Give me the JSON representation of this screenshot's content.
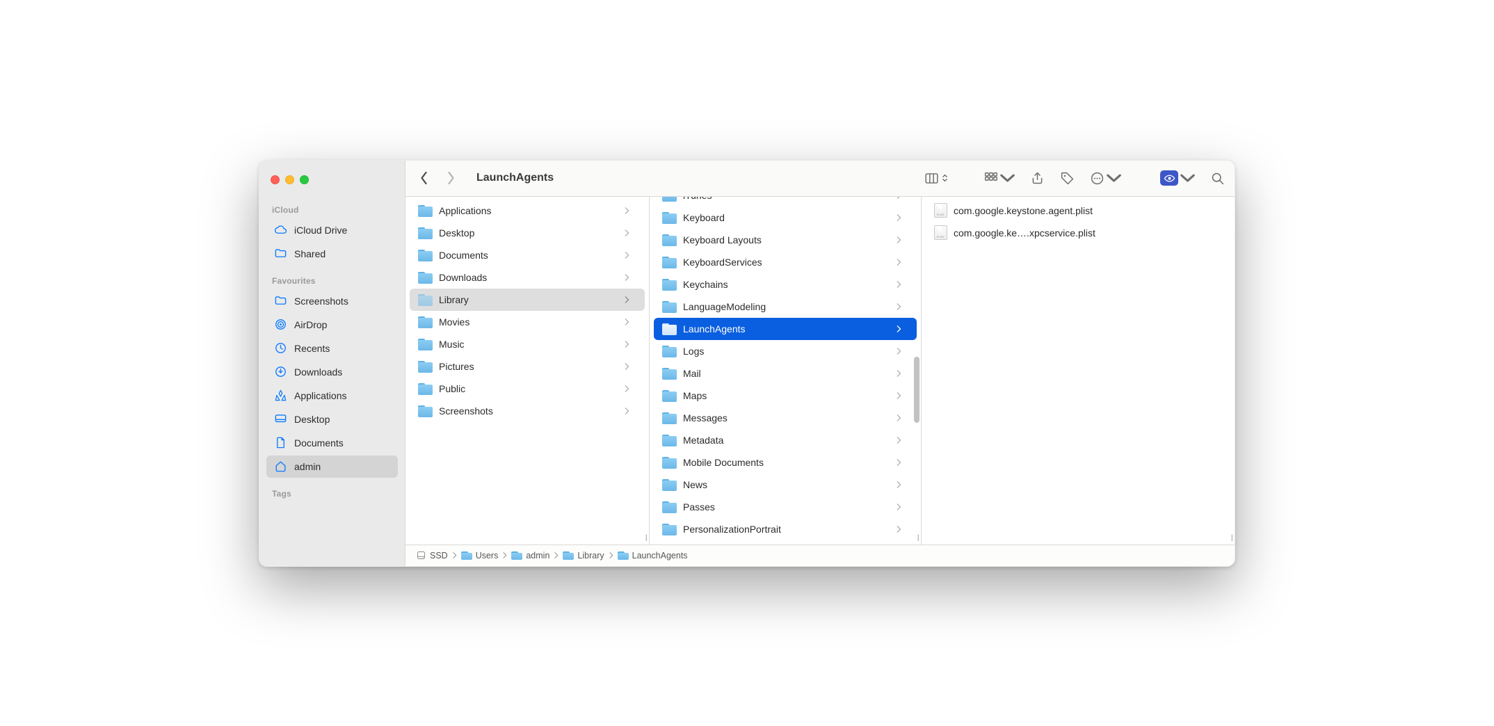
{
  "window_title": "LaunchAgents",
  "sidebar": {
    "sections": [
      {
        "header": "iCloud",
        "items": [
          {
            "icon": "cloud",
            "label": "iCloud Drive"
          },
          {
            "icon": "folder-shared",
            "label": "Shared"
          }
        ]
      },
      {
        "header": "Favourites",
        "items": [
          {
            "icon": "folder",
            "label": "Screenshots"
          },
          {
            "icon": "airdrop",
            "label": "AirDrop"
          },
          {
            "icon": "clock",
            "label": "Recents"
          },
          {
            "icon": "download",
            "label": "Downloads"
          },
          {
            "icon": "apps",
            "label": "Applications"
          },
          {
            "icon": "desktop",
            "label": "Desktop"
          },
          {
            "icon": "document",
            "label": "Documents"
          },
          {
            "icon": "home",
            "label": "admin",
            "selected": true
          }
        ]
      },
      {
        "header": "Tags",
        "items": []
      }
    ]
  },
  "columns": [
    {
      "items": [
        {
          "type": "folder",
          "label": "Applications",
          "has_children": true
        },
        {
          "type": "folder",
          "label": "Desktop",
          "has_children": true
        },
        {
          "type": "folder",
          "label": "Documents",
          "has_children": true
        },
        {
          "type": "folder",
          "label": "Downloads",
          "has_children": true
        },
        {
          "type": "folder",
          "label": "Library",
          "has_children": true,
          "open": true
        },
        {
          "type": "folder",
          "label": "Movies",
          "has_children": true
        },
        {
          "type": "folder",
          "label": "Music",
          "has_children": true
        },
        {
          "type": "folder",
          "label": "Pictures",
          "has_children": true
        },
        {
          "type": "folder",
          "label": "Public",
          "has_children": true
        },
        {
          "type": "folder",
          "label": "Screenshots",
          "has_children": true
        }
      ]
    },
    {
      "items": [
        {
          "type": "folder",
          "label": "iTunes",
          "has_children": true
        },
        {
          "type": "folder",
          "label": "Keyboard",
          "has_children": true
        },
        {
          "type": "folder",
          "label": "Keyboard Layouts",
          "has_children": true
        },
        {
          "type": "folder",
          "label": "KeyboardServices",
          "has_children": true
        },
        {
          "type": "folder",
          "label": "Keychains",
          "has_children": true
        },
        {
          "type": "folder",
          "label": "LanguageModeling",
          "has_children": true
        },
        {
          "type": "folder",
          "label": "LaunchAgents",
          "has_children": true,
          "selected": true
        },
        {
          "type": "folder",
          "label": "Logs",
          "has_children": true
        },
        {
          "type": "folder",
          "label": "Mail",
          "has_children": true
        },
        {
          "type": "folder",
          "label": "Maps",
          "has_children": true
        },
        {
          "type": "folder",
          "label": "Messages",
          "has_children": true
        },
        {
          "type": "folder",
          "label": "Metadata",
          "has_children": true
        },
        {
          "type": "folder",
          "label": "Mobile Documents",
          "has_children": true
        },
        {
          "type": "folder",
          "label": "News",
          "has_children": true
        },
        {
          "type": "folder",
          "label": "Passes",
          "has_children": true
        },
        {
          "type": "folder",
          "label": "PersonalizationPortrait",
          "has_children": true
        }
      ]
    },
    {
      "items": [
        {
          "type": "plist",
          "label": "com.google.keystone.agent.plist"
        },
        {
          "type": "plist",
          "label": "com.google.ke….xpcservice.plist"
        }
      ]
    }
  ],
  "path": [
    {
      "icon": "disk",
      "label": "SSD"
    },
    {
      "icon": "folder",
      "label": "Users"
    },
    {
      "icon": "folder",
      "label": "admin"
    },
    {
      "icon": "folder",
      "label": "Library"
    },
    {
      "icon": "folder",
      "label": "LaunchAgents"
    }
  ]
}
